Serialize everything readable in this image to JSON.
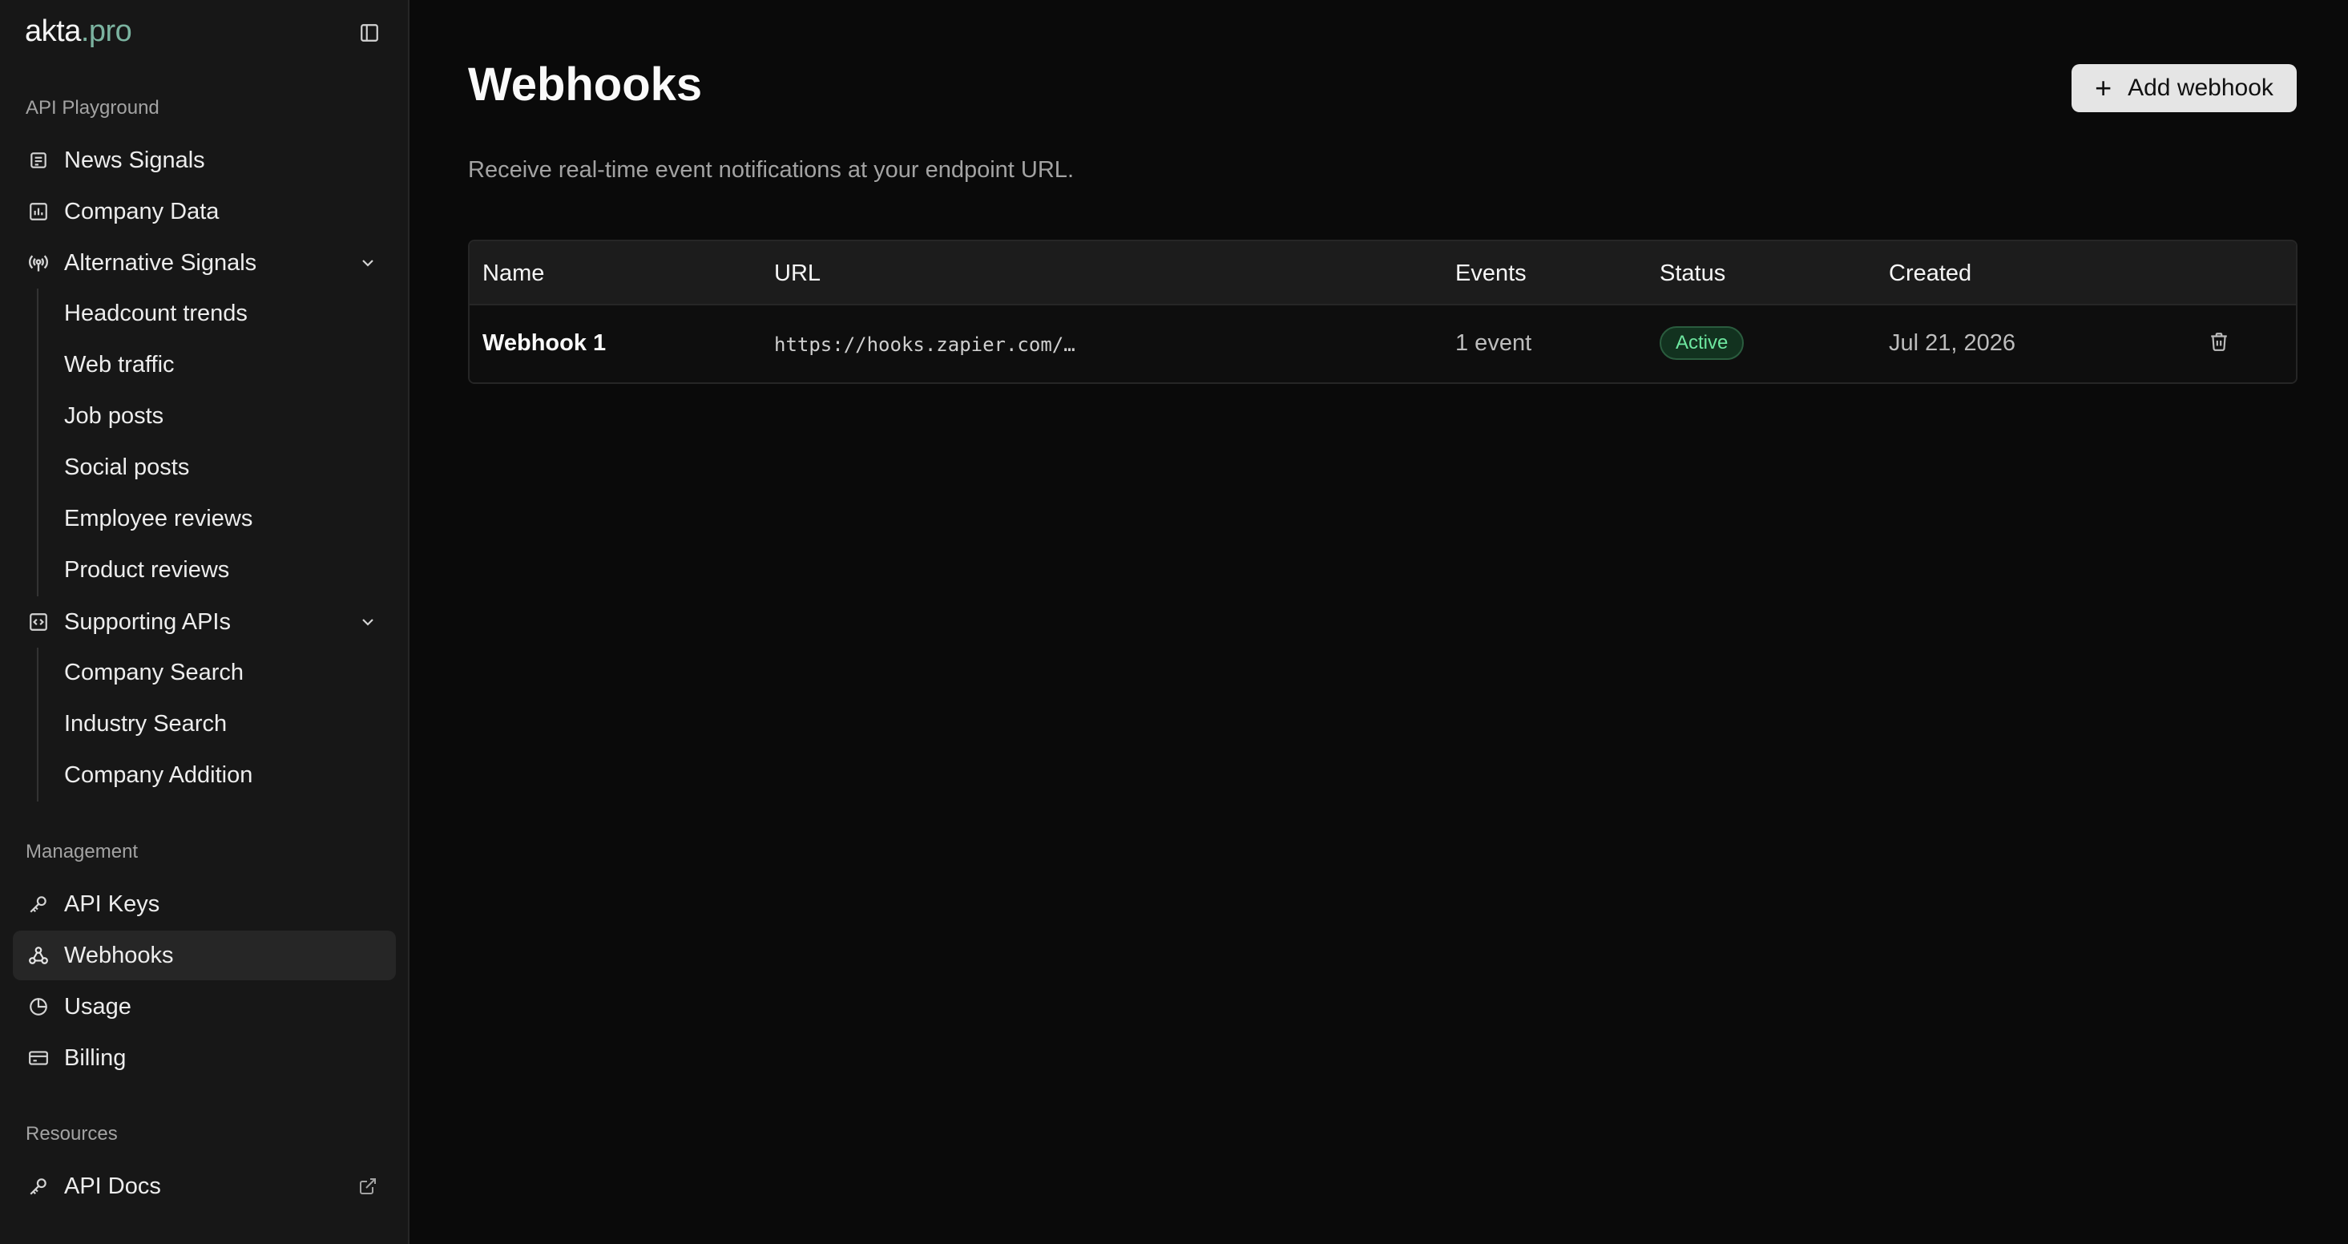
{
  "brand": {
    "name": "akta",
    "suffix": ".pro"
  },
  "sidebar": {
    "sections": {
      "playground": "API Playground",
      "management": "Management",
      "resources": "Resources"
    },
    "items": {
      "news_signals": "News Signals",
      "company_data": "Company Data",
      "alternative_signals": "Alternative Signals",
      "supporting_apis": "Supporting APIs",
      "api_keys": "API Keys",
      "webhooks": "Webhooks",
      "usage": "Usage",
      "billing": "Billing",
      "api_docs": "API Docs"
    },
    "alternative_sub": [
      "Headcount trends",
      "Web traffic",
      "Job posts",
      "Social posts",
      "Employee reviews",
      "Product reviews"
    ],
    "supporting_sub": [
      "Company Search",
      "Industry Search",
      "Company Addition"
    ],
    "active": "webhooks"
  },
  "main": {
    "title": "Webhooks",
    "description": "Receive real-time event notifications at your endpoint URL.",
    "add_button": "Add webhook",
    "table": {
      "headers": {
        "name": "Name",
        "url": "URL",
        "events": "Events",
        "status": "Status",
        "created": "Created"
      },
      "rows": [
        {
          "name": "Webhook 1",
          "url": "https://hooks.zapier.com/…",
          "events": "1 event",
          "status": "Active",
          "created": "Jul 21, 2026"
        }
      ]
    }
  },
  "colors": {
    "accent": "#7bb3a0",
    "status_active": "#6ee7a0",
    "background": "#0a0a0a",
    "sidebar": "#171717"
  }
}
